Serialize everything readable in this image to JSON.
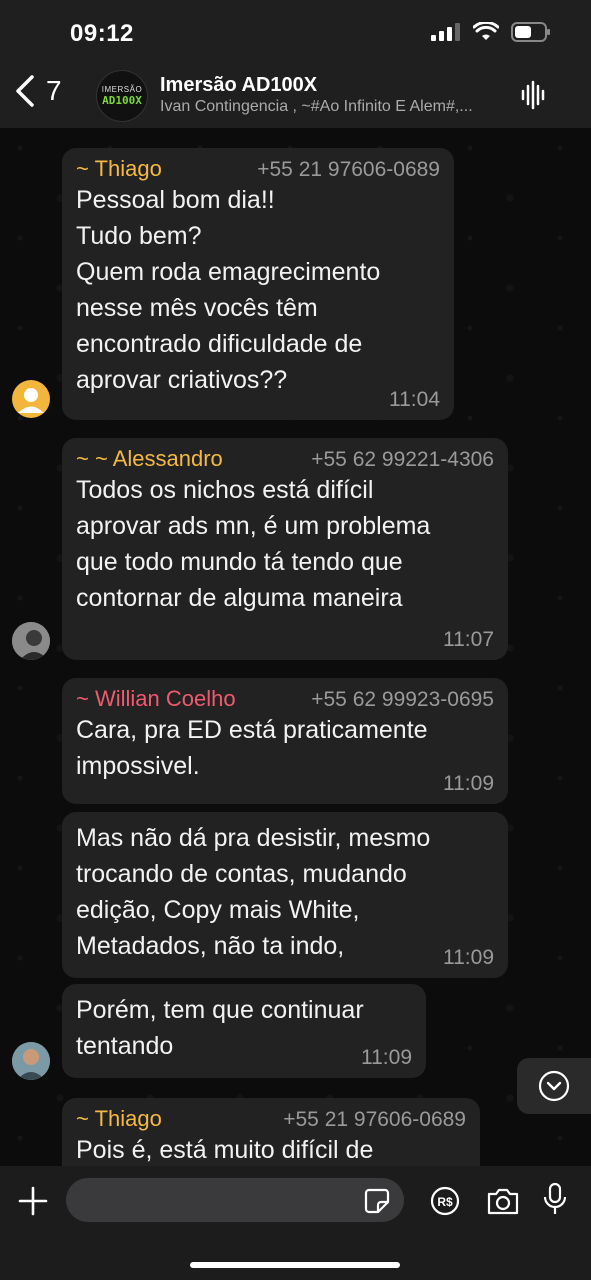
{
  "status": {
    "time": "09:12"
  },
  "header": {
    "back_count": "7",
    "avatar_line1": "IMERSÃO",
    "avatar_line2": "AD100X",
    "title": "Imersão AD100X",
    "subtitle": "Ivan Contingencia , ~#Ao Infinito E Alem#,..."
  },
  "colors": {
    "thiago": "#f5b942",
    "alessandro": "#f5b942",
    "willian": "#ef5a6f"
  },
  "messages": [
    {
      "name": "~ Thiago",
      "phone": "+55 21 97606-0689",
      "text": "Pessoal bom dia!!\nTudo bem?\nQuem roda emagrecimento\nnesse mês vocês têm\nencontrado dificuldade de\naprovar criativos??",
      "time": "11:04"
    },
    {
      "name": "~ ~ Alessandro",
      "phone": "+55 62 99221-4306",
      "text": "Todos os nichos está difícil\naprovar ads mn, é um problema\nque todo mundo tá tendo que\ncontornar de alguma maneira",
      "time": "11:07"
    },
    {
      "name": "~ Willian Coelho",
      "phone": "+55 62 99923-0695",
      "text": "Cara, pra ED está praticamente\nimpossivel.",
      "time": "11:09"
    },
    {
      "text": "Mas não dá pra desistir, mesmo\ntrocando de contas, mudando\nedição, Copy mais White,\nMetadados, não ta indo,",
      "time": "11:09"
    },
    {
      "text": "Porém, tem que continuar\ntentando",
      "time": "11:09"
    },
    {
      "name": "~ Thiago",
      "phone": "+55 21 97606-0689",
      "text": "Pois é, está muito difícil de"
    }
  ],
  "composer": {
    "placeholder": ""
  }
}
